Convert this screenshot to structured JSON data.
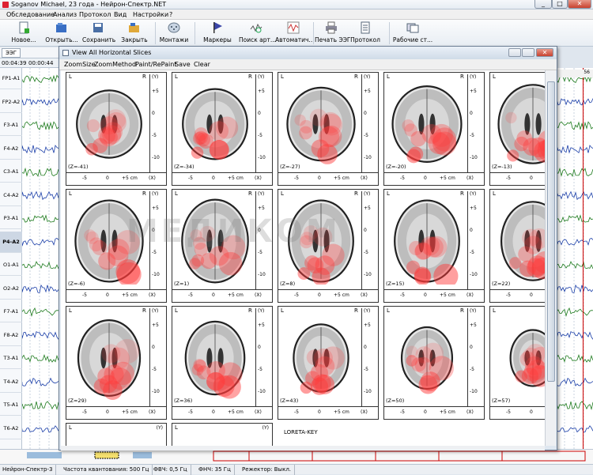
{
  "main_window": {
    "title": "Soganov Michael, 23 года - Нейрон-Спектр.NET",
    "controls": [
      "_",
      "□",
      "✕"
    ]
  },
  "menu": [
    "Обследование",
    "Анализ",
    "Протокол",
    "Вид",
    "Настройки",
    "?"
  ],
  "toolbar": [
    {
      "label": "Новое...",
      "icon": "new-document-icon"
    },
    {
      "label": "Открыть...",
      "icon": "open-folder-icon"
    },
    {
      "label": "Сохранить",
      "icon": "save-icon"
    },
    {
      "label": "Закрыть",
      "icon": "close-folder-icon"
    },
    {
      "label": "Монтажи",
      "icon": "montage-icon"
    },
    {
      "label": "Маркеры",
      "icon": "marker-flag-icon"
    },
    {
      "label": "Поиск арт...",
      "icon": "search-artifacts-icon"
    },
    {
      "label": "Автоматич...",
      "icon": "automatic-icon"
    },
    {
      "label": "Печать ЭЭГ",
      "icon": "print-icon"
    },
    {
      "label": "Протокол",
      "icon": "protocol-icon"
    },
    {
      "label": "Рабочие ст...",
      "icon": "workspaces-icon"
    }
  ],
  "eeg_tab": "ЭЭГ",
  "time_fields": [
    "00:04:39",
    "00:00:44"
  ],
  "channels": [
    "FP1-A1",
    "FP2-A2",
    "F3-A1",
    "F4-A2",
    "C3-A1",
    "C4-A2",
    "P3-A1",
    "P4-A2",
    "O1-A1",
    "O2-A2",
    "F7-A1",
    "F8-A2",
    "T3-A1",
    "T4-A2",
    "T5-A1",
    "T6-A2"
  ],
  "selected_channel": "P4-A2",
  "right_marker": "56",
  "child_window": {
    "title": "View All Horizontal Slices",
    "menu": [
      "ZoomSize",
      "ZoomMethod",
      "Paint/RePaint",
      "Save",
      "Clear"
    ]
  },
  "panel_labels": {
    "left": "L",
    "right": "R",
    "y_axis": "(Y)",
    "x_axis": "(X)",
    "y_ticks": [
      "+5",
      "0",
      "-5",
      "-10"
    ],
    "x_ticks": [
      "-5",
      "0",
      "+5 cm"
    ]
  },
  "slices": [
    {
      "z": "(Z=-41)"
    },
    {
      "z": "(Z=-34)"
    },
    {
      "z": "(Z=-27)"
    },
    {
      "z": "(Z=-20)"
    },
    {
      "z": "(Z=-13)"
    },
    {
      "z": "(Z=-6)"
    },
    {
      "z": "(Z=1)"
    },
    {
      "z": "(Z=8)"
    },
    {
      "z": "(Z=15)"
    },
    {
      "z": "(Z=22)"
    },
    {
      "z": "(Z=29)"
    },
    {
      "z": "(Z=36)"
    },
    {
      "z": "(Z=43)"
    },
    {
      "z": "(Z=50)"
    },
    {
      "z": "(Z=57)"
    }
  ],
  "legend_key": "LORETA-KEY",
  "watermark": "МЕДИКОМ",
  "status": [
    "Нейрон-Спектр-3",
    "Частота квантования: 500 Гц",
    "ФВЧ: 0,5 Гц",
    "ФНЧ: 35 Гц",
    "Режектор: Выкл."
  ]
}
